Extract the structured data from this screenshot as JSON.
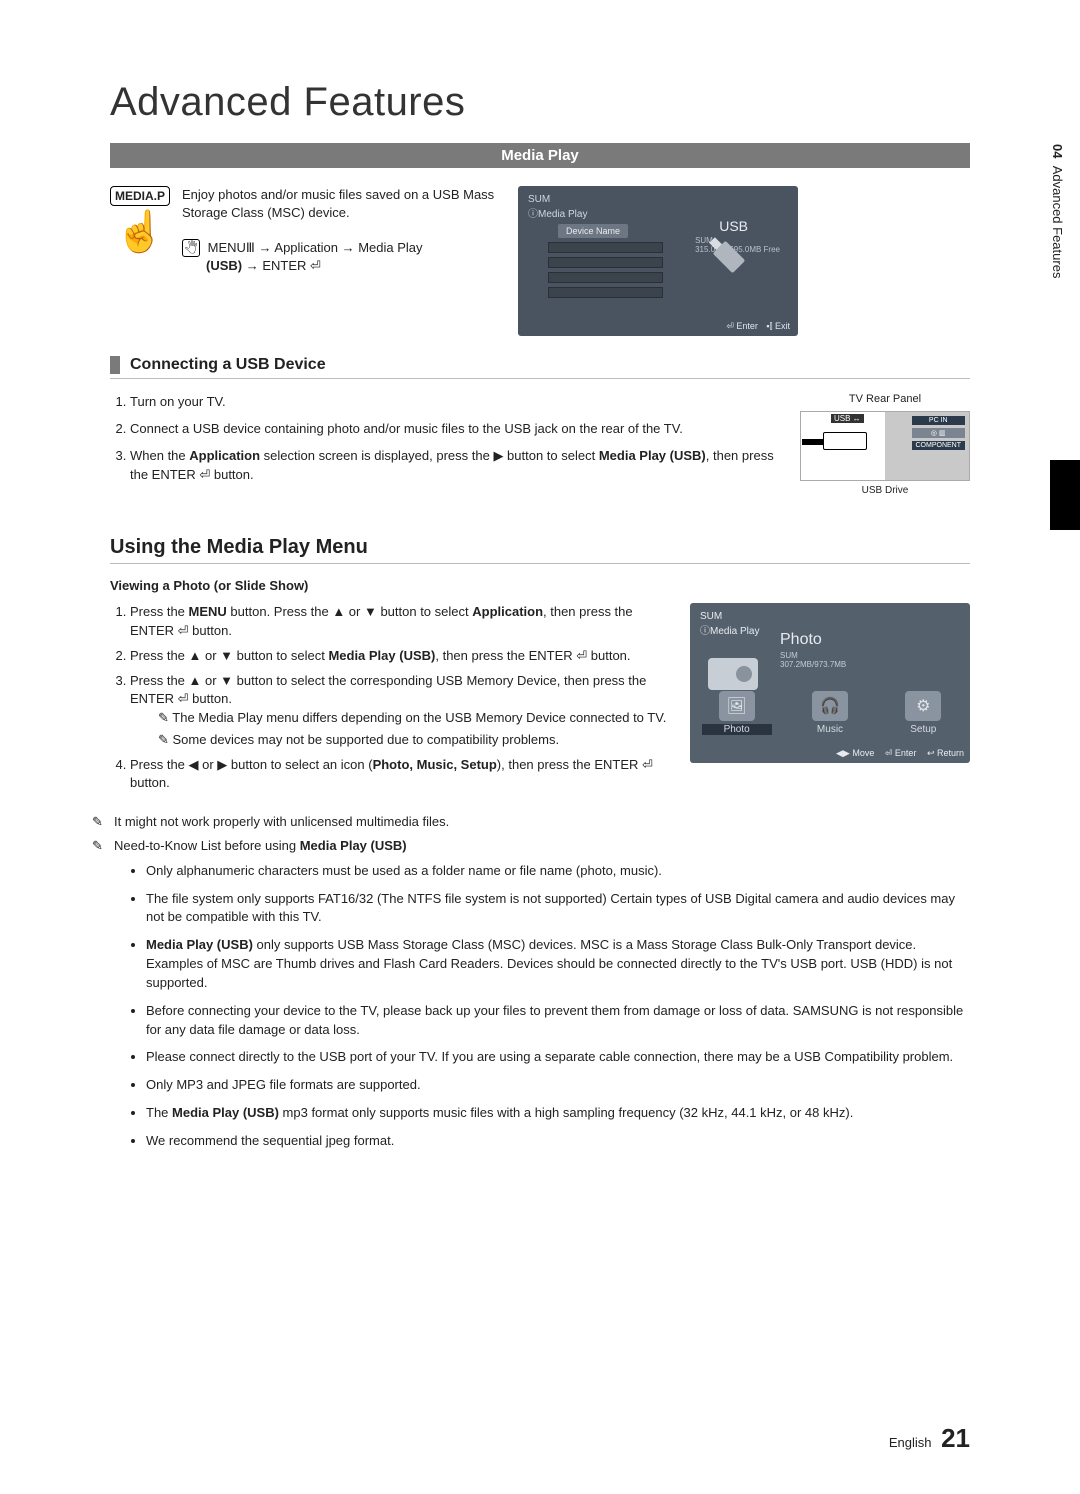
{
  "title": "Advanced Features",
  "sidebar": {
    "chapter_no": "04",
    "chapter_title": "Advanced Features"
  },
  "media_play_bar": "Media Play",
  "media_p_btn": "MEDIA.P",
  "intro_text": "Enjoy photos and/or music files saved on a USB Mass Storage Class (MSC) device.",
  "menu_path_html": "MENU Ⅲ → Application → Media Play (USB) → ENTER ⏎",
  "menu_path_prefix": "MENU",
  "menu_path_mid": " → Application → Media Play",
  "menu_path_line2_prefix": "(USB)",
  "menu_path_line2_suffix": " → ENTER ⏎",
  "screen1": {
    "header": "SUM\nⓘMedia Play",
    "device_name": "Device Name",
    "usb": "USB",
    "sum": "SUM",
    "free": "315.0MB/695.0MB Free",
    "enter": "⏎ Enter",
    "exit": "▪⫿ Exit"
  },
  "connecting": {
    "heading": "Connecting a USB Device",
    "step1": "Turn on your TV.",
    "step2": "Connect a USB device containing photo and/or music files to the USB jack on the rear of the TV.",
    "step3_a": "When the ",
    "step3_b": "Application",
    "step3_c": " selection screen is displayed, press the ▶ button to select ",
    "step3_d": "Media Play (USB)",
    "step3_e": ", then press the ENTER ⏎ button.",
    "rear_caption": "TV Rear Panel",
    "usb_drive": "USB Drive",
    "port_usb": "USB ↔",
    "port_pc": "PC IN",
    "port_comp": "COMPONENT"
  },
  "using": {
    "heading": "Using the Media Play Menu",
    "view_photo": "Viewing a Photo (or Slide Show)",
    "s1_a": "Press the ",
    "s1_b": "MENU",
    "s1_c": " button. Press the ▲ or ▼ button to select ",
    "s1_d": "Application",
    "s1_e": ", then press the ENTER ⏎ button.",
    "s2_a": "Press the ▲ or ▼ button to select ",
    "s2_b": "Media Play (USB)",
    "s2_c": ", then press the ENTER ⏎ button.",
    "s3": "Press the ▲ or ▼ button to select the corresponding USB Memory Device, then press the ENTER ⏎ button.",
    "s3_n1": "The Media Play menu differs depending on the USB Memory Device connected to TV.",
    "s3_n2": "Some devices may not be supported due to compatibility problems.",
    "s4_a": "Press the ◀ or ▶ button to select an icon (",
    "s4_b": "Photo, Music, Setup",
    "s4_c": "), then press the ENTER ⏎ button."
  },
  "screen2": {
    "header": "SUM\nⓘMedia Play",
    "title": "Photo",
    "sub_sum": "SUM",
    "sub_free": "307.2MB/973.7MB",
    "opt_photo": "Photo",
    "opt_music": "Music",
    "opt_setup": "Setup",
    "move": "◀▶ Move",
    "enter": "⏎ Enter",
    "return": "↩ Return"
  },
  "final": {
    "n1": "It might not work properly with unlicensed multimedia files.",
    "n2_a": "Need-to-Know List before using ",
    "n2_b": "Media Play (USB)"
  },
  "bullets": {
    "b1": "Only alphanumeric characters must be used as a folder name or file name (photo, music).",
    "b2": "The file system only supports FAT16/32 (The NTFS file system is not supported) Certain types of USB Digital camera and audio devices may not be compatible with this TV.",
    "b3_a": "Media Play (USB)",
    "b3_b": " only supports USB Mass Storage Class (MSC) devices. MSC is a Mass Storage Class Bulk-Only Transport device. Examples of MSC are Thumb drives and Flash Card Readers. Devices should be connected directly to the TV's USB port. USB (HDD) is not supported.",
    "b4": "Before connecting your device to the TV, please back up your files to prevent them from damage or loss of data. SAMSUNG is not responsible for any data file damage or data loss.",
    "b5": "Please connect directly to the USB port of your TV. If you are using a separate cable connection, there may be a USB Compatibility problem.",
    "b6": "Only MP3 and JPEG file formats are supported.",
    "b7_a": "The ",
    "b7_b": "Media Play (USB)",
    "b7_c": " mp3 format only supports music files with a high sampling frequency (32 kHz, 44.1 kHz, or 48 kHz).",
    "b8": "We recommend the sequential jpeg format."
  },
  "footer": {
    "lang": "English",
    "page": "21"
  }
}
